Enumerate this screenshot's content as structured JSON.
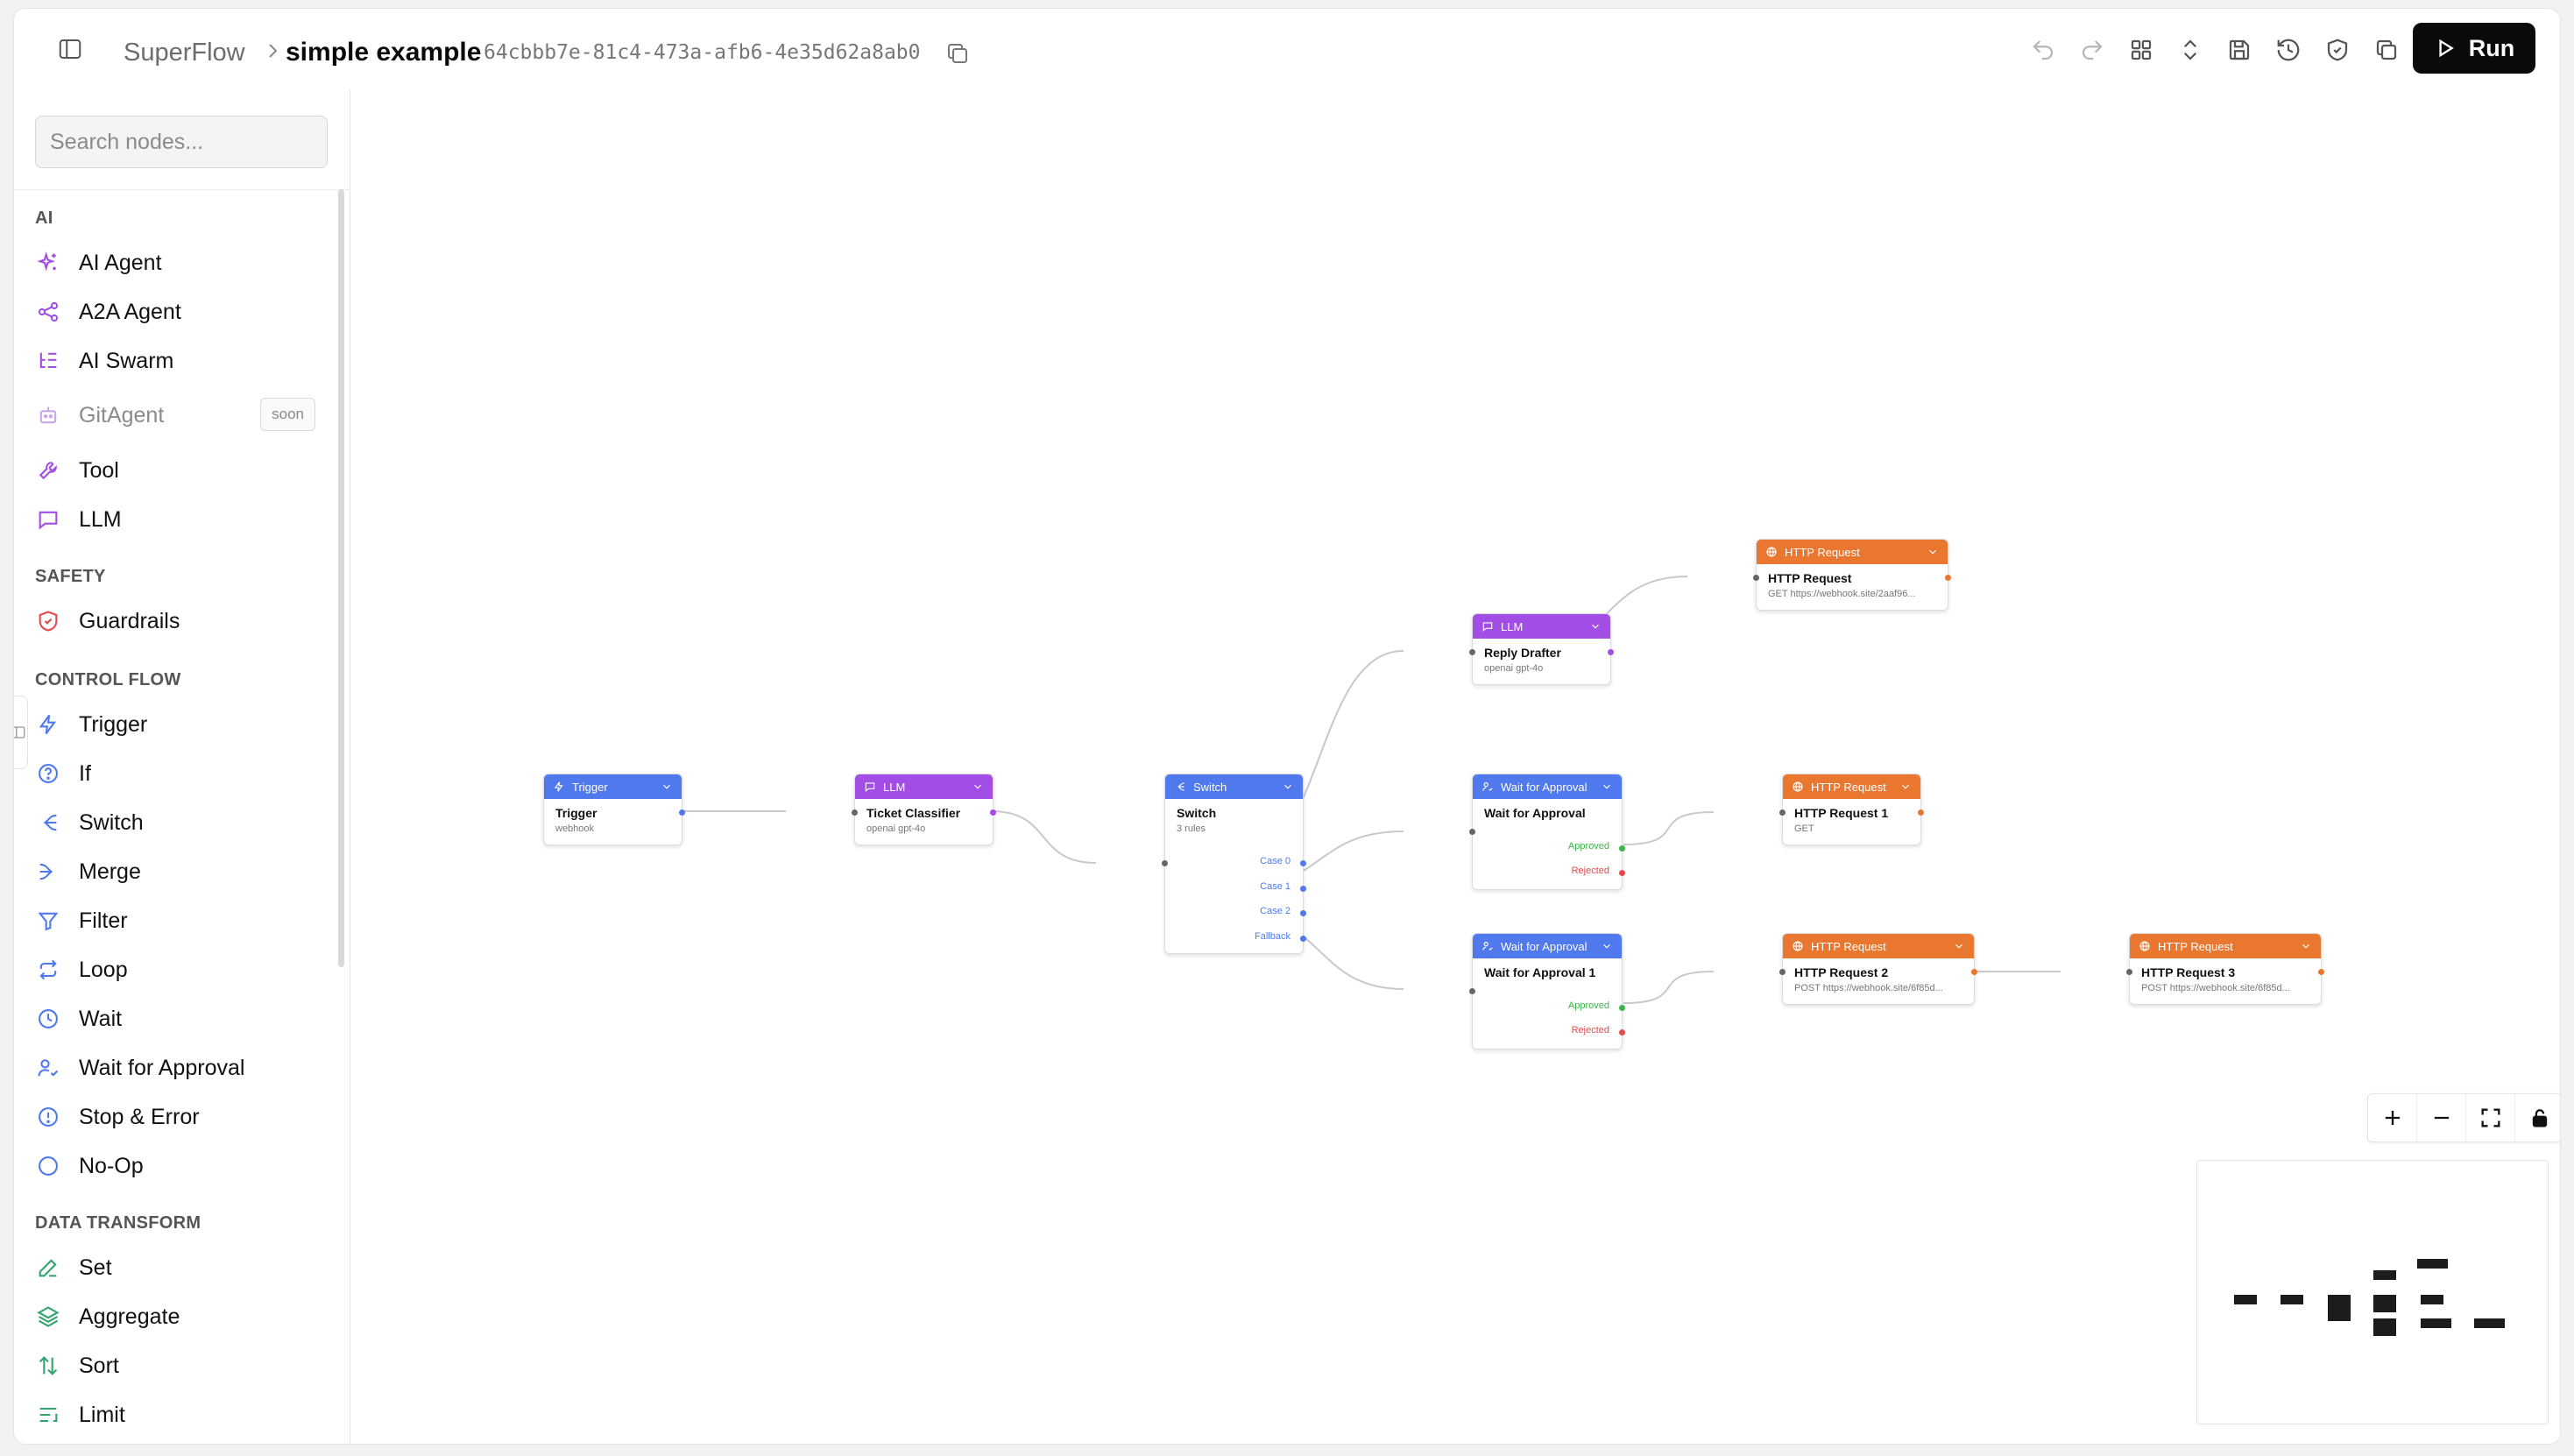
{
  "header": {
    "app_name": "SuperFlow",
    "workflow_title": "simple example",
    "workflow_id": "64cbbb7e-81c4-473a-afb6-4e35d62a8ab0",
    "run_label": "Run"
  },
  "sidebar": {
    "search_placeholder": "Search nodes...",
    "categories": [
      {
        "label": "AI",
        "items": [
          {
            "label": "AI Agent",
            "icon": "sparkles-icon"
          },
          {
            "label": "A2A Agent",
            "icon": "share-nodes-icon"
          },
          {
            "label": "AI Swarm",
            "icon": "list-tree-icon"
          },
          {
            "label": "GitAgent",
            "icon": "bot-icon",
            "badge": "soon"
          },
          {
            "label": "Tool",
            "icon": "wrench-icon"
          },
          {
            "label": "LLM",
            "icon": "message-square-icon"
          }
        ]
      },
      {
        "label": "SAFETY",
        "items": [
          {
            "label": "Guardrails",
            "icon": "shield-check-icon"
          }
        ]
      },
      {
        "label": "CONTROL FLOW",
        "items": [
          {
            "label": "Trigger",
            "icon": "zap-icon"
          },
          {
            "label": "If",
            "icon": "help-circle-icon"
          },
          {
            "label": "Switch",
            "icon": "split-icon"
          },
          {
            "label": "Merge",
            "icon": "merge-icon"
          },
          {
            "label": "Filter",
            "icon": "filter-icon"
          },
          {
            "label": "Loop",
            "icon": "repeat-icon"
          },
          {
            "label": "Wait",
            "icon": "clock-icon"
          },
          {
            "label": "Wait for Approval",
            "icon": "user-check-icon"
          },
          {
            "label": "Stop & Error",
            "icon": "alert-circle-icon"
          },
          {
            "label": "No-Op",
            "icon": "circle-icon"
          }
        ]
      },
      {
        "label": "DATA TRANSFORM",
        "items": [
          {
            "label": "Set",
            "icon": "pencil-icon"
          },
          {
            "label": "Aggregate",
            "icon": "layers-icon"
          },
          {
            "label": "Sort",
            "icon": "arrow-up-down-icon"
          },
          {
            "label": "Limit",
            "icon": "list-end-icon"
          }
        ]
      }
    ]
  },
  "nodes": {
    "trigger": {
      "type": "Trigger",
      "title": "Trigger",
      "sub": "webhook"
    },
    "classifier": {
      "type": "LLM",
      "title": "Ticket Classifier",
      "sub": "openai gpt-4o"
    },
    "switch": {
      "type": "Switch",
      "title": "Switch",
      "sub": "3 rules",
      "outputs": [
        "Case 0",
        "Case 1",
        "Case 2",
        "Fallback"
      ]
    },
    "drafter": {
      "type": "LLM",
      "title": "Reply Drafter",
      "sub": "openai gpt-4o"
    },
    "http0": {
      "type": "HTTP Request",
      "title": "HTTP Request",
      "sub": "GET https://webhook.site/2aaf96..."
    },
    "approval": {
      "type": "Wait for Approval",
      "title": "Wait for Approval",
      "outputs": [
        "Approved",
        "Rejected"
      ]
    },
    "http1": {
      "type": "HTTP Request",
      "title": "HTTP Request 1",
      "sub": "GET"
    },
    "approval1": {
      "type": "Wait for Approval",
      "title": "Wait for Approval 1",
      "outputs": [
        "Approved",
        "Rejected"
      ]
    },
    "http2": {
      "type": "HTTP Request",
      "title": "HTTP Request 2",
      "sub": "POST https://webhook.site/6f85d..."
    },
    "http3": {
      "type": "HTTP Request",
      "title": "HTTP Request 3",
      "sub": "POST https://webhook.site/6f85d..."
    }
  },
  "colors": {
    "llm": "#a24ee6",
    "control": "#4f79ec",
    "http": "#e9772f",
    "approved": "#3bb54a",
    "rejected": "#e5484d",
    "run": "#0a0a0a"
  },
  "toolbar_icons": [
    "undo-icon",
    "redo-icon",
    "layout-grid-icon",
    "chevrons-up-down-icon",
    "save-icon",
    "history-icon",
    "shield-check-icon",
    "copy-icon"
  ]
}
